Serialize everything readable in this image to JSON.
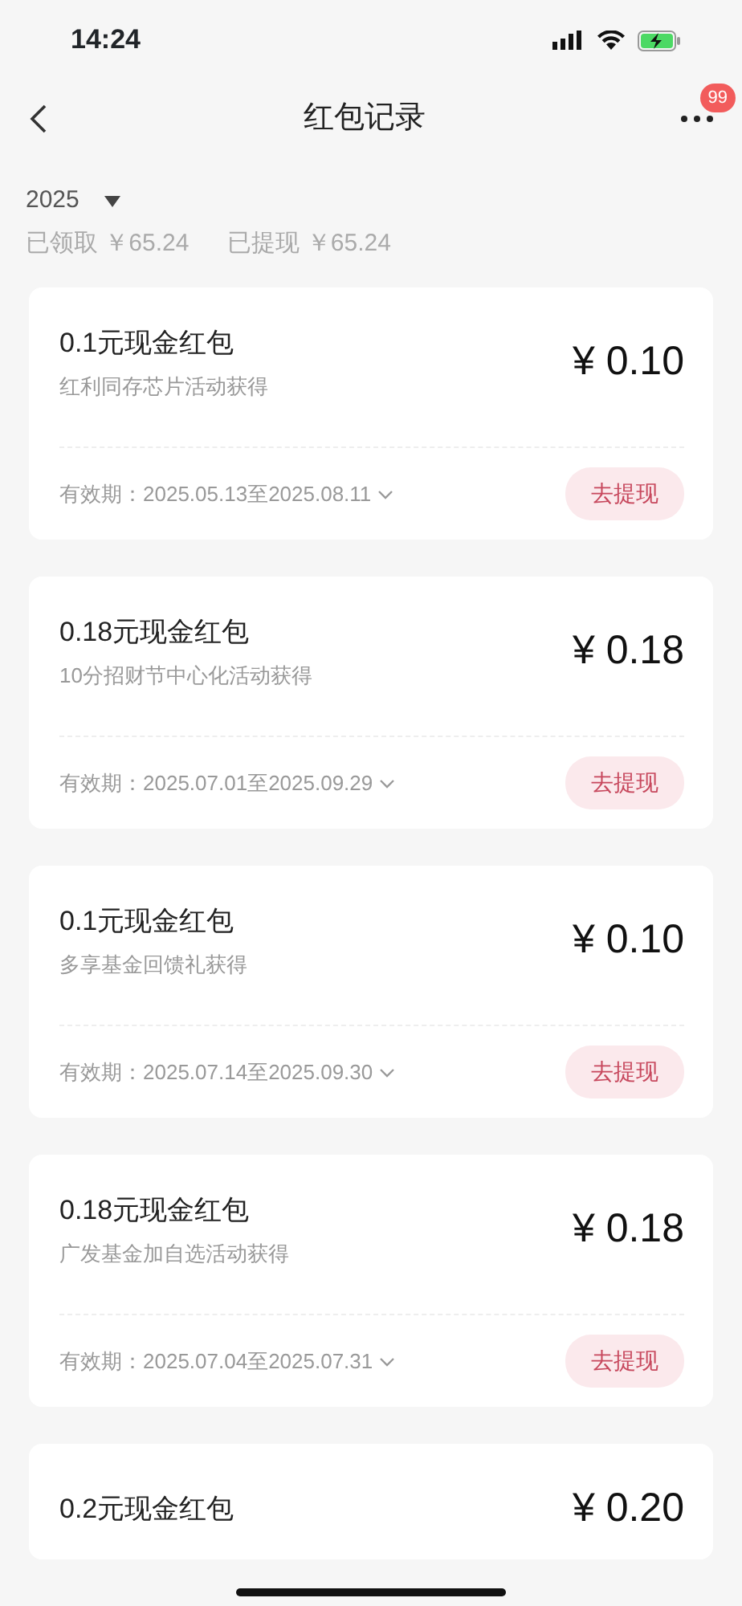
{
  "status_bar": {
    "time": "14:24",
    "battery_charging": true
  },
  "nav": {
    "title": "红包记录",
    "badge": "99"
  },
  "filter": {
    "year": "2025"
  },
  "summary": [
    {
      "label": "已领取",
      "amount": "￥65.24"
    },
    {
      "label": "已提现",
      "amount": "￥65.24"
    }
  ],
  "cards": [
    {
      "title": "0.1元现金红包",
      "source": "红利同存芯片活动获得",
      "amount": "¥ 0.10",
      "validity": "有效期：2025.05.13至2025.08.11",
      "button": "去提现"
    },
    {
      "title": "0.18元现金红包",
      "source": "10分招财节中心化活动获得",
      "amount": "¥ 0.18",
      "validity": "有效期：2025.07.01至2025.09.29",
      "button": "去提现"
    },
    {
      "title": "0.1元现金红包",
      "source": "多享基金回馈礼获得",
      "amount": "¥ 0.10",
      "validity": "有效期：2025.07.14至2025.09.30",
      "button": "去提现"
    },
    {
      "title": "0.18元现金红包",
      "source": "广发基金加自选活动获得",
      "amount": "¥ 0.18",
      "validity": "有效期：2025.07.04至2025.07.31",
      "button": "去提现"
    },
    {
      "title": "0.2元现金红包",
      "amount": "¥ 0.20"
    }
  ]
}
